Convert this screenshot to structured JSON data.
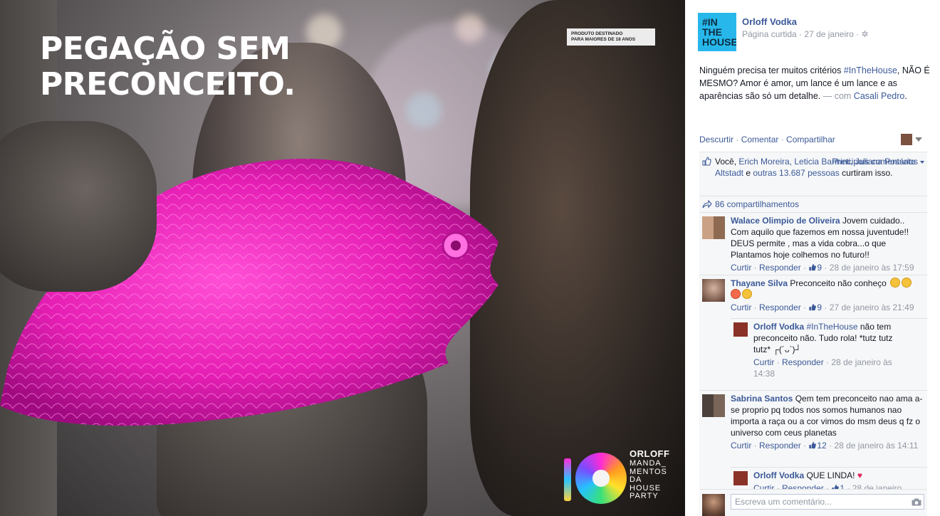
{
  "photo": {
    "headline_line1": "PEGAÇÃO SEM",
    "headline_line2": "PRECONCEITO.",
    "age_badge_line1": "PRODUTO DESTINADO",
    "age_badge_line2": "PARA MAIORES DE 18 ANOS",
    "brand_logo": "ORLOFF",
    "brand_tag_lines": [
      "MANDA_",
      "MENTOS",
      "DA",
      "HOUSE",
      "PARTY"
    ]
  },
  "post": {
    "page_avatar_line1": "#IN",
    "page_avatar_line2": "THE",
    "page_avatar_line3": "HOUSE",
    "page_name": "Orloff Vodka",
    "meta_type": "Página curtida",
    "meta_date": "27 de janeiro",
    "text_part1": "Ninguém precisa ter muitos critérios ",
    "hashtag": "#InTheHouse",
    "text_part2": ", NÃO É MESMO? Amor é amor, um lance é um lance e as aparências são só um detalhe.",
    "with_label": " — com ",
    "with_name": "Casali Pedro",
    "with_end": "."
  },
  "actions": {
    "unlike": "Descurtir",
    "comment": "Comentar",
    "share": "Compartilhar",
    "sep": " · "
  },
  "likes": {
    "you": "Você, ",
    "names": "Erich Moreira, Leticia Banheti, Juliana Possato Altstadt",
    "and": " e ",
    "others": "outras 13.687 pessoas",
    "suffix": " curtiram isso.",
    "sort_label": "Principais comentários"
  },
  "shares": {
    "label": "86 compartilhamentos"
  },
  "comments": [
    {
      "author": "Walace Olimpio de Oliveira",
      "text": "Jovem cuidado.. Com aquilo que fazemos em nossa juventude!! DEUS permite , mas a vida cobra...o que Plantamos hoje colhemos no futuro!!",
      "like_label": "Curtir",
      "reply_label": "Responder",
      "likes": "9",
      "time": "28 de janeiro às 17:59"
    },
    {
      "author": "Thayane Silva",
      "text": "Preconceito não conheço",
      "like_label": "Curtir",
      "reply_label": "Responder",
      "likes": "9",
      "time": "27 de janeiro às 21:49"
    },
    {
      "author": "Sabrina Santos",
      "text": "Qem tem preconceito nao ama a-se proprio pq todos nos somos humanos nao importa a raça ou a cor vimos do msm deus q fz o universo com ceus planetas",
      "like_label": "Curtir",
      "reply_label": "Responder",
      "likes": "12",
      "time": "28 de janeiro às 14:11"
    }
  ],
  "replies": [
    {
      "author": "Orloff Vodka",
      "hashtag": "#InTheHouse",
      "text": " não tem preconceito não. Tudo rola! *tutz tutz tutz*  ┌(´ᴗ`)┘",
      "like_label": "Curtir",
      "reply_label": "Responder",
      "time": "28 de janeiro às 14:38"
    },
    {
      "author": "Orloff Vodka",
      "text": "QUE LINDA!",
      "like_label": "Curtir",
      "reply_label": "Responder",
      "likes": "1",
      "time": "28 de janeiro"
    }
  ],
  "composer": {
    "placeholder": "Escreva um comentário..."
  },
  "colors": {
    "link": "#3b5998",
    "fish": "#e61fb4",
    "muted": "#9197a3"
  }
}
